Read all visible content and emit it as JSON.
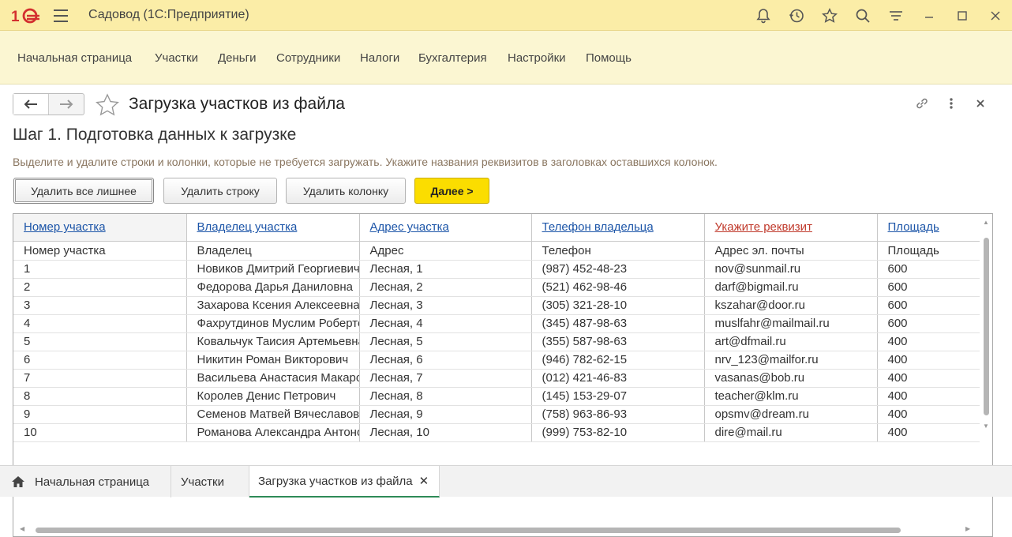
{
  "app": {
    "title": "Садовод  (1С:Предприятие)"
  },
  "toolbar_icons": [
    "bell-icon",
    "history-icon",
    "star-icon",
    "search-icon",
    "filter-icon",
    "minimize-icon",
    "maximize-icon",
    "close-icon"
  ],
  "sections": [
    "Начальная страница",
    "Участки",
    "Деньги",
    "Сотрудники",
    "Налоги",
    "Бухгалтерия",
    "Настройки",
    "Помощь"
  ],
  "form": {
    "title": "Загрузка участков из файла",
    "step_title": "Шаг 1. Подготовка данных к загрузке",
    "hint": "Выделите и удалите строки и колонки, которые не требуется загружать. Укажите названия реквизитов в заголовках оставшихся колонок.",
    "buttons": {
      "delete_extra": "Удалить все лишнее",
      "delete_row": "Удалить строку",
      "delete_column": "Удалить колонку",
      "next": "Далее >"
    }
  },
  "table": {
    "headers": [
      "Номер участка",
      "Владелец участка",
      "Адрес участка",
      "Телефон владельца",
      "Укажите реквизит",
      "Площадь"
    ],
    "subheaders": [
      "Номер участка",
      "Владелец",
      "Адрес",
      "Телефон",
      "Адрес эл. почты",
      "Площадь"
    ],
    "rows": [
      [
        "1",
        "Новиков Дмитрий Георгиевич",
        "Лесная, 1",
        "(987) 452-48-23",
        "nov@sunmail.ru",
        "600"
      ],
      [
        "2",
        "Федорова Дарья Даниловна",
        "Лесная, 2",
        "(521) 462-98-46",
        "darf@bigmail.ru",
        "600"
      ],
      [
        "3",
        "Захарова Ксения Алексеевна",
        "Лесная, 3",
        "(305) 321-28-10",
        "kszahar@door.ru",
        "600"
      ],
      [
        "4",
        "Фахрутдинов Муслим Робертович",
        "Лесная, 4",
        "(345) 487-98-63",
        "muslfahr@mailmail.ru",
        "600"
      ],
      [
        "5",
        "Ковальчук Таисия Артемьевна",
        "Лесная, 5",
        "(355) 587-98-63",
        "art@dfmail.ru",
        "400"
      ],
      [
        "6",
        "Никитин Роман Викторович",
        "Лесная, 6",
        "(946) 782-62-15",
        "nrv_123@mailfor.ru",
        "400"
      ],
      [
        "7",
        "Васильева Анастасия Макаровна",
        "Лесная, 7",
        "(012) 421-46-83",
        "vasanas@bob.ru",
        "400"
      ],
      [
        "8",
        "Королев Денис Петрович",
        "Лесная, 8",
        "(145) 153-29-07",
        "teacher@klm.ru",
        "400"
      ],
      [
        "9",
        "Семенов Матвей Вячеславович",
        "Лесная, 9",
        "(758) 963-86-93",
        "opsmv@dream.ru",
        "400"
      ],
      [
        "10",
        "Романова Александра Антоновна",
        "Лесная, 10",
        "(999) 753-82-10",
        "dire@mail.ru",
        "400"
      ]
    ]
  },
  "tabs": [
    {
      "label": "Начальная страница",
      "icon": "home-icon"
    },
    {
      "label": "Участки"
    },
    {
      "label": "Загрузка участков из файла",
      "active": true
    }
  ],
  "colors": {
    "accent": "#fbdd00",
    "link": "#1c55a8",
    "warning": "#c0392b"
  }
}
